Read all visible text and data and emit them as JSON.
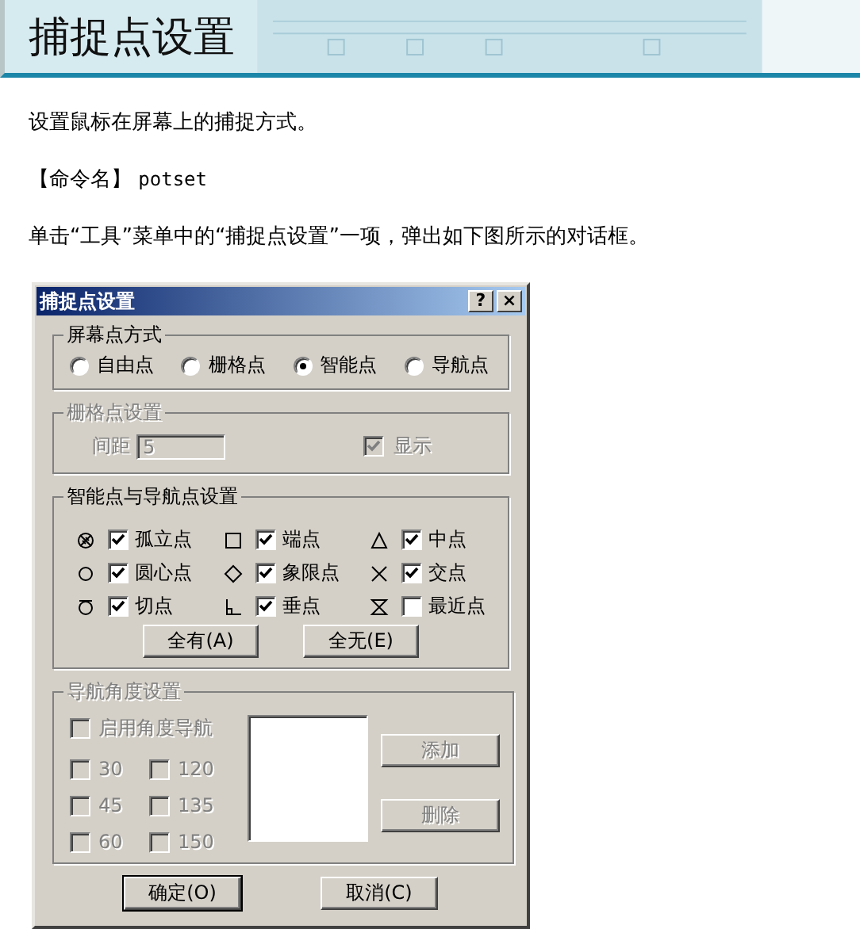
{
  "page": {
    "title": "捕捉点设置",
    "intro": "设置鼠标在屏幕上的捕捉方式。",
    "command_label": "【命令名】",
    "command": "potset",
    "instruction": "单击“工具”菜单中的“捕捉点设置”一项，弹出如下图所示的对话框。"
  },
  "dialog": {
    "title": "捕捉点设置",
    "help_button": "?",
    "close_button": "×",
    "screen_point_mode": {
      "label": "屏幕点方式",
      "options": [
        {
          "label": "自由点",
          "selected": false
        },
        {
          "label": "栅格点",
          "selected": false
        },
        {
          "label": "智能点",
          "selected": true
        },
        {
          "label": "导航点",
          "selected": false
        }
      ]
    },
    "grid_settings": {
      "label": "栅格点设置",
      "disabled": true,
      "spacing_label": "间距",
      "spacing_value": "5",
      "show": {
        "label": "显示",
        "checked": true
      }
    },
    "snap_settings": {
      "label": "智能点与导航点设置",
      "items": [
        {
          "label": "孤立点",
          "checked": true
        },
        {
          "label": "端点",
          "checked": true
        },
        {
          "label": "中点",
          "checked": true
        },
        {
          "label": "圆心点",
          "checked": true
        },
        {
          "label": "象限点",
          "checked": true
        },
        {
          "label": "交点",
          "checked": true
        },
        {
          "label": "切点",
          "checked": true
        },
        {
          "label": "垂点",
          "checked": true
        },
        {
          "label": "最近点",
          "checked": false
        }
      ],
      "buttons": [
        "全有(A)",
        "全无(E)"
      ]
    },
    "nav_angle": {
      "label": "导航角度设置",
      "disabled": true,
      "enable": {
        "label": "启用角度导航",
        "checked": false
      },
      "angles": [
        {
          "label": "30",
          "checked": false
        },
        {
          "label": "120",
          "checked": false
        },
        {
          "label": "45",
          "checked": false
        },
        {
          "label": "135",
          "checked": false
        },
        {
          "label": "60",
          "checked": false
        },
        {
          "label": "150",
          "checked": false
        }
      ],
      "buttons": [
        "添加",
        "删除"
      ]
    },
    "buttons": [
      {
        "label": "确定(O)",
        "default": true
      },
      {
        "label": "取消(C)",
        "default": false
      }
    ]
  }
}
